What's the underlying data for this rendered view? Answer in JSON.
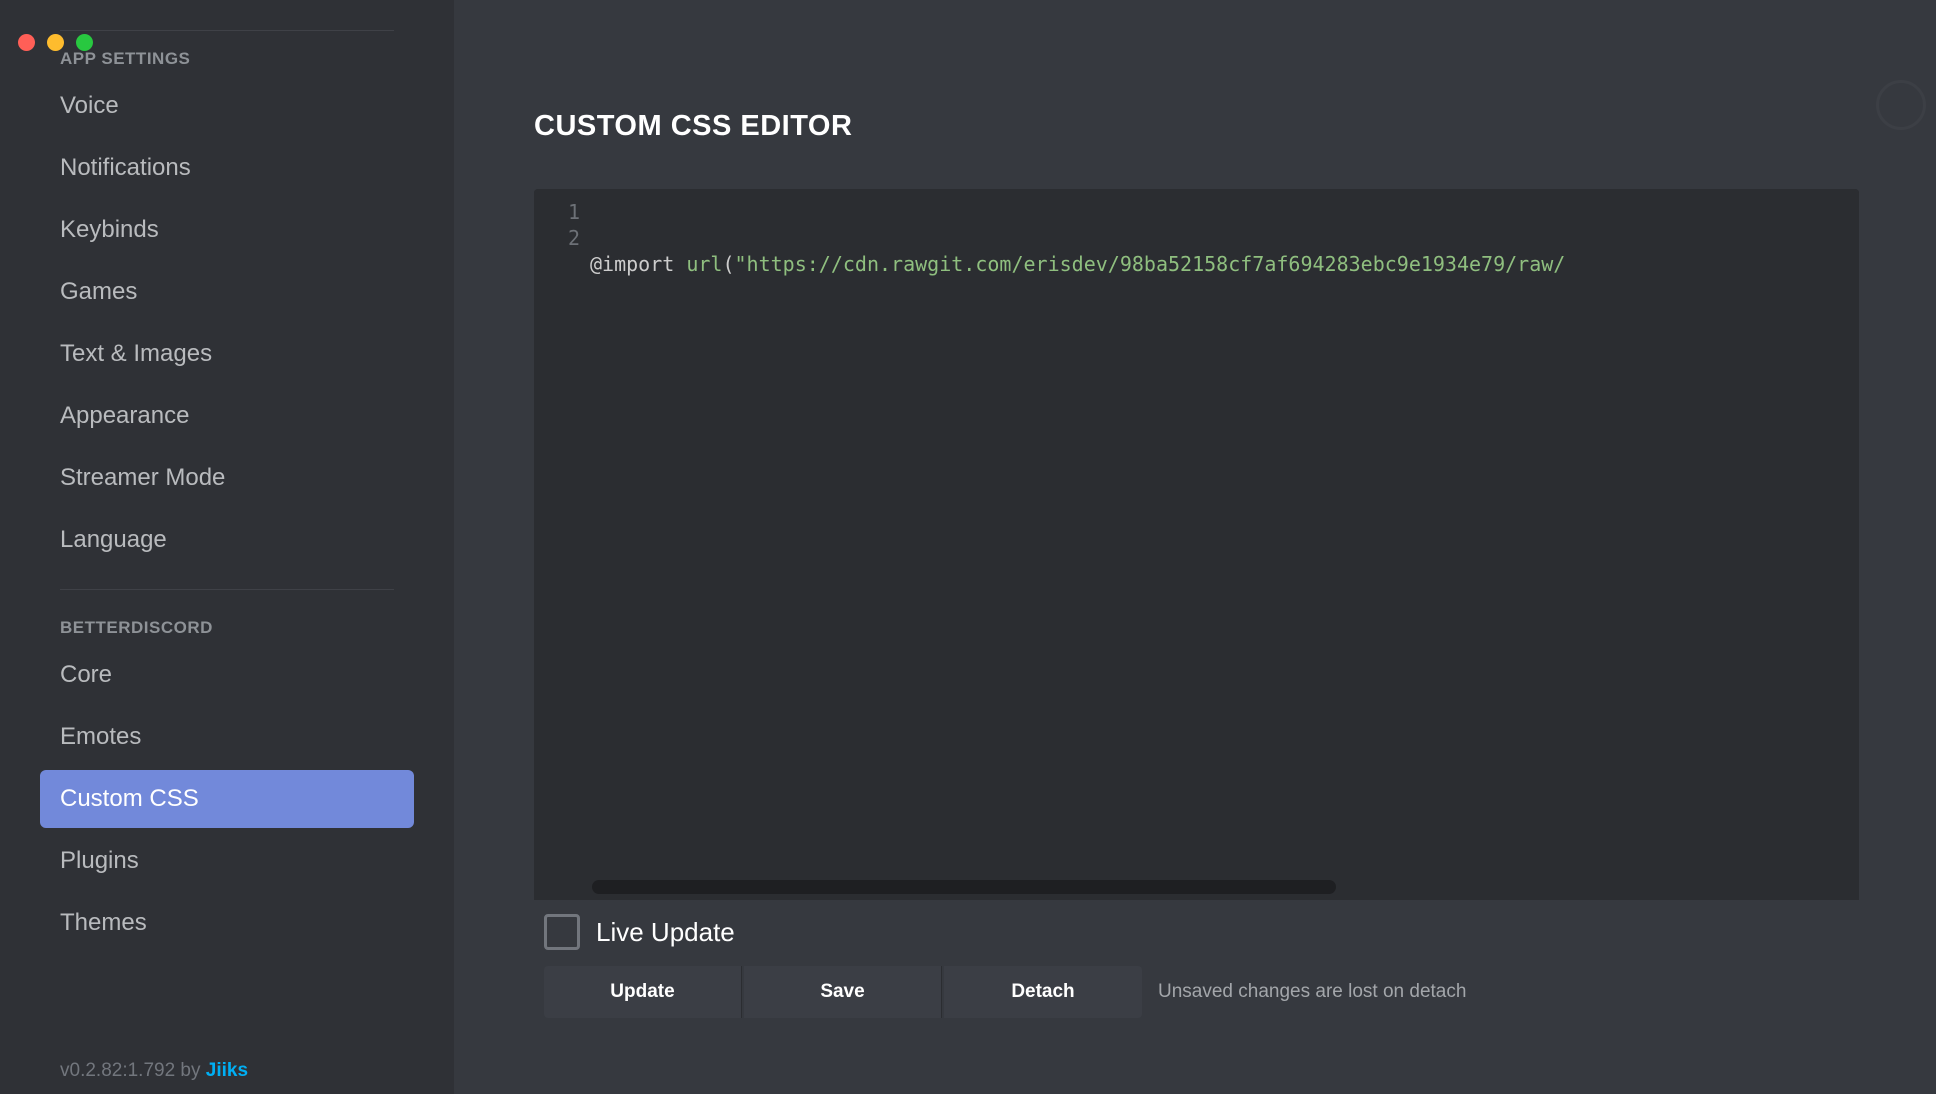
{
  "window": {
    "traffic_lights": [
      "close",
      "minimize",
      "maximize"
    ]
  },
  "sidebar": {
    "section_app": {
      "header": "APP SETTINGS",
      "items": [
        {
          "id": "voice",
          "label": "Voice",
          "active": false
        },
        {
          "id": "notifications",
          "label": "Notifications",
          "active": false
        },
        {
          "id": "keybinds",
          "label": "Keybinds",
          "active": false
        },
        {
          "id": "games",
          "label": "Games",
          "active": false
        },
        {
          "id": "text-images",
          "label": "Text & Images",
          "active": false
        },
        {
          "id": "appearance",
          "label": "Appearance",
          "active": false
        },
        {
          "id": "streamer-mode",
          "label": "Streamer Mode",
          "active": false
        },
        {
          "id": "language",
          "label": "Language",
          "active": false
        }
      ]
    },
    "section_bd": {
      "header": "BETTERDISCORD",
      "items": [
        {
          "id": "core",
          "label": "Core",
          "active": false
        },
        {
          "id": "emotes",
          "label": "Emotes",
          "active": false
        },
        {
          "id": "custom-css",
          "label": "Custom CSS",
          "active": true
        },
        {
          "id": "plugins",
          "label": "Plugins",
          "active": false
        },
        {
          "id": "themes",
          "label": "Themes",
          "active": false
        }
      ]
    },
    "version": {
      "prefix": "v0.2.82:1.792 by ",
      "author": "Jiiks"
    }
  },
  "main": {
    "title": "CUSTOM CSS EDITOR",
    "editor": {
      "line_numbers": [
        "1",
        "2"
      ],
      "code_tokens": {
        "atrule": "@import",
        "space": " ",
        "func": "url",
        "open": "(",
        "string": "\"https://cdn.rawgit.com/erisdev/98ba52158cf7af694283ebc9e1934e79/raw/",
        "close": ""
      }
    },
    "live_update": {
      "checked": false,
      "label": "Live Update"
    },
    "buttons": {
      "update": "Update",
      "save": "Save",
      "detach": "Detach"
    },
    "hint": "Unsaved changes are lost on detach"
  }
}
